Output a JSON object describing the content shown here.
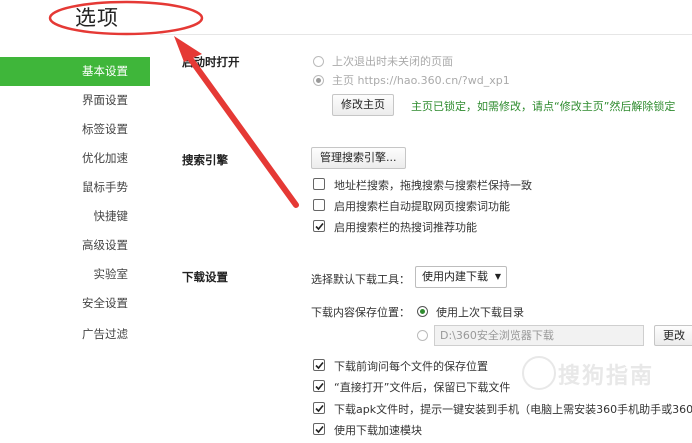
{
  "title": "选项",
  "sidebar": {
    "items": [
      {
        "label": "基本设置",
        "active": true
      },
      {
        "label": "界面设置"
      },
      {
        "label": "标签设置"
      },
      {
        "label": "优化加速"
      },
      {
        "label": "鼠标手势"
      },
      {
        "label": "快捷键"
      },
      {
        "label": "高级设置"
      },
      {
        "label": "实验室"
      },
      {
        "label": "安全设置"
      },
      {
        "label": "广告过滤"
      }
    ]
  },
  "startup": {
    "label": "启动时打开",
    "options": [
      "上次退出时未关闭的页面",
      "主页  https://hao.360.cn/?wd_xp1"
    ],
    "change_home_button": "修改主页",
    "locked_note": "主页已锁定，如需修改，请点“修改主页”然后解除锁定"
  },
  "search": {
    "label": "搜索引擎",
    "manage_button": "管理搜索引擎...",
    "options": [
      {
        "label": "地址栏搜索，拖拽搜索与搜索栏保持一致",
        "checked": false
      },
      {
        "label": "启用搜索栏自动提取网页搜索词功能",
        "checked": false
      },
      {
        "label": "启用搜索栏的热搜词推荐功能",
        "checked": true
      }
    ]
  },
  "download": {
    "label": "下载设置",
    "tool_label": "选择默认下载工具：",
    "tool_value": "使用内建下载",
    "location_label": "下载内容保存位置：",
    "location_options": [
      "使用上次下载目录"
    ],
    "path_value": "D:\\360安全浏览器下载",
    "change_button": "更改",
    "options": [
      {
        "label": "下载前询问每个文件的保存位置",
        "checked": true
      },
      {
        "label": "“直接打开”文件后，保留已下载文件",
        "checked": true
      },
      {
        "label": "下载apk文件时，提示一键安装到手机（电脑上需安装360手机助手或360",
        "checked": true
      },
      {
        "label": "使用下载加速模块",
        "checked": true
      }
    ]
  },
  "watermark": "搜狗指南",
  "colors": {
    "accent": "#3fb63a",
    "annotation": "#e53935",
    "locked_note": "#2e8b2e"
  }
}
